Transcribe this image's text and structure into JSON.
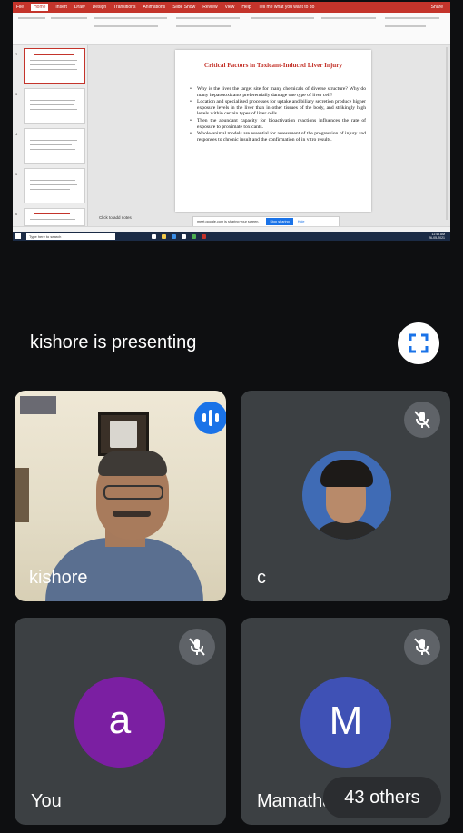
{
  "ppt": {
    "tabs": [
      "File",
      "Home",
      "Insert",
      "Draw",
      "Design",
      "Transitions",
      "Animations",
      "Slide Show",
      "Review",
      "View",
      "Help"
    ],
    "active_tab_index": 1,
    "tell_me": "Tell me what you want to do",
    "share": "Share",
    "slide_title": "Critical Factors in Toxicant-Induced Liver Injury",
    "bullets": [
      "Why is the liver the target site for many chemicals of diverse structure? Why do many hepatotoxicants preferentially damage one type of liver cell?",
      "Location and specialized processes for uptake and biliary secretion produce higher exposure levels in the liver than in other tissues of the body, and strikingly high levels within certain types of liver cells.",
      "Then the abundant capacity for bioactivation reactions influences the rate of exposure to proximate toxicants.",
      "Whole-animal models are essential for assessment of the progression of injury and responses to chronic insult and the confirmation of in vitro results."
    ],
    "notes_placeholder": "Click to add notes",
    "slide_numbers": [
      "2",
      "3",
      "4",
      "5",
      "6"
    ],
    "sharing_banner": "meet.google.com is sharing your screen.",
    "stop_sharing": "Stop sharing",
    "hide": "Hide",
    "taskbar_search": "Type here to search",
    "clock_time": "11:45 AM",
    "clock_date": "26-05-2021"
  },
  "meet": {
    "presenting_text": "kishore is presenting",
    "participants": [
      {
        "name": "kishore",
        "speaking": true,
        "muted": false
      },
      {
        "name": "c",
        "speaking": false,
        "muted": true
      },
      {
        "name": "You",
        "initial": "a",
        "avatar_color": "#7b1fa2",
        "muted": true
      },
      {
        "name": "Mamatha",
        "initial": "M",
        "avatar_color": "#3f51b5",
        "muted": true
      }
    ],
    "others_label": "43 others"
  },
  "colors": {
    "background": "#0e0f11",
    "tile": "#3c4043",
    "ppt_accent": "#c4342b",
    "speaking_blue": "#1a73e8"
  }
}
